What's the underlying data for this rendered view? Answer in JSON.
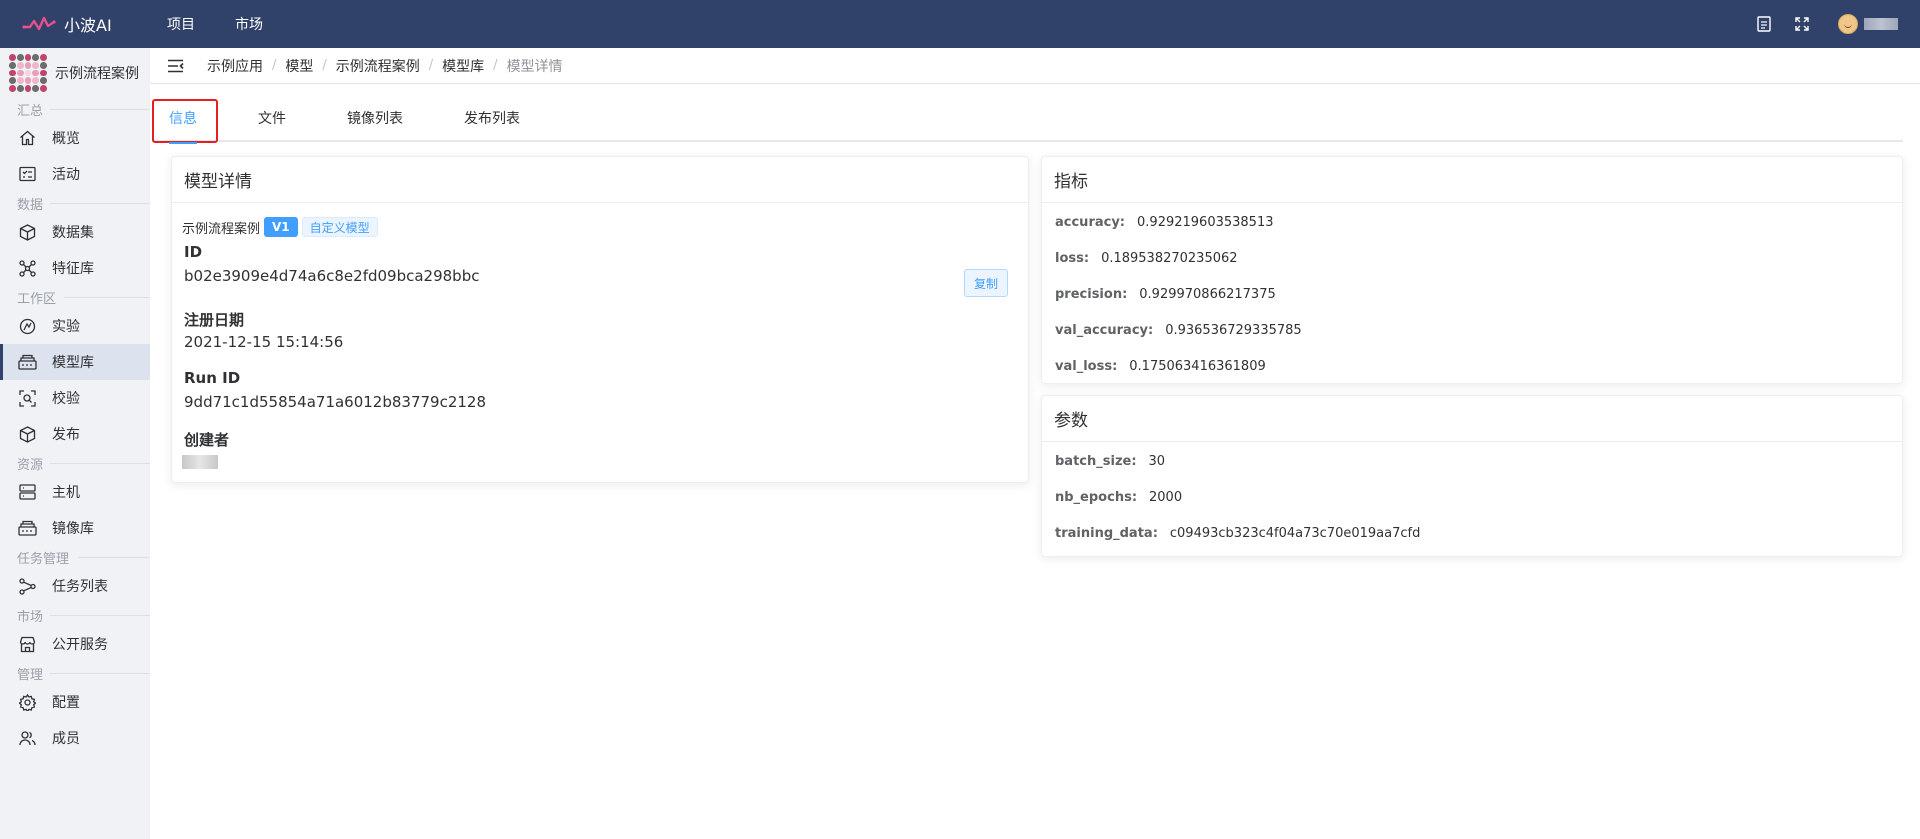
{
  "app": {
    "name": "小波AI",
    "nav": [
      "项目",
      "市场"
    ]
  },
  "project": {
    "name": "示例流程案例"
  },
  "sidebar": {
    "sections": [
      {
        "label": "汇总",
        "items": [
          {
            "label": "概览",
            "icon": "home-icon"
          },
          {
            "label": "活动",
            "icon": "activity-icon"
          }
        ]
      },
      {
        "label": "数据",
        "items": [
          {
            "label": "数据集",
            "icon": "cube-icon"
          },
          {
            "label": "特征库",
            "icon": "graph-icon"
          }
        ]
      },
      {
        "label": "工作区",
        "items": [
          {
            "label": "实验",
            "icon": "experiment-icon"
          },
          {
            "label": "模型库",
            "icon": "model-icon",
            "active": true
          },
          {
            "label": "校验",
            "icon": "validate-icon"
          },
          {
            "label": "发布",
            "icon": "publish-icon"
          }
        ]
      },
      {
        "label": "资源",
        "items": [
          {
            "label": "主机",
            "icon": "server-icon"
          },
          {
            "label": "镜像库",
            "icon": "image-repo-icon"
          }
        ]
      },
      {
        "label": "任务管理",
        "items": [
          {
            "label": "任务列表",
            "icon": "task-list-icon"
          }
        ]
      },
      {
        "label": "市场",
        "items": [
          {
            "label": "公开服务",
            "icon": "store-icon"
          }
        ]
      },
      {
        "label": "管理",
        "items": [
          {
            "label": "配置",
            "icon": "gear-icon"
          },
          {
            "label": "成员",
            "icon": "members-icon"
          }
        ]
      }
    ]
  },
  "breadcrumb": [
    "示例应用",
    "模型",
    "示例流程案例",
    "模型库",
    "模型详情"
  ],
  "tabs": [
    {
      "label": "信息",
      "active": true
    },
    {
      "label": "文件"
    },
    {
      "label": "镜像列表"
    },
    {
      "label": "发布列表"
    }
  ],
  "model": {
    "title": "模型详情",
    "name": "示例流程案例",
    "version": "V1",
    "type_tag": "自定义模型",
    "id_label": "ID",
    "id_value": "b02e3909e4d74a6c8e2fd09bca298bbc",
    "copy_label": "复制",
    "date_label": "注册日期",
    "date_value": "2021-12-15 15:14:56",
    "run_label": "Run ID",
    "run_value": "9dd71c1d55854a71a6012b83779c2128",
    "creator_label": "创建者"
  },
  "metrics": {
    "title": "指标",
    "items": [
      {
        "key": "accuracy:",
        "value": "0.929219603538513"
      },
      {
        "key": "loss:",
        "value": "0.189538270235062"
      },
      {
        "key": "precision:",
        "value": "0.929970866217375"
      },
      {
        "key": "val_accuracy:",
        "value": "0.936536729335785"
      },
      {
        "key": "val_loss:",
        "value": "0.175063416361809"
      }
    ]
  },
  "params": {
    "title": "参数",
    "items": [
      {
        "key": "batch_size:",
        "value": "30"
      },
      {
        "key": "nb_epochs:",
        "value": "2000"
      },
      {
        "key": "training_data:",
        "value": "c09493cb323c4f04a73c70e019aa7cfd"
      }
    ]
  },
  "colors": {
    "topbar": "#304269",
    "accent": "#409eff",
    "highlight": "#e62020"
  }
}
